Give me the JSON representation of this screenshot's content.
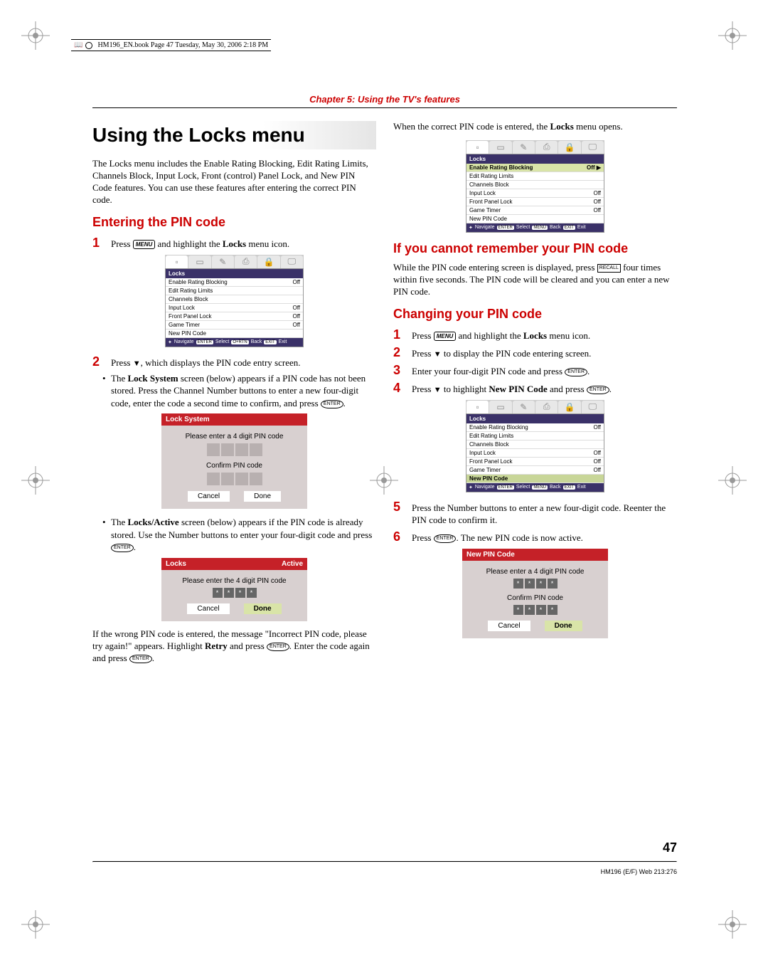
{
  "book_header": "HM196_EN.book  Page 47  Tuesday, May 30, 2006  2:18 PM",
  "chapter": "Chapter 5: Using the TV's features",
  "h1": "Using the Locks menu",
  "intro": "The Locks menu includes the Enable Rating Blocking, Edit Rating Limits, Channels Block, Input Lock, Front (control) Panel Lock, and New PIN Code features. You can use these features after entering the correct PIN code.",
  "sub_enter": "Entering the PIN code",
  "step1_fmt": "Press {MENU} and highlight the {LOCKS} menu icon.",
  "locks_label": "Locks",
  "step2_fmt": "Press {DOWN}, which displays the PIN code entry screen.",
  "bullet1_prefix": "The ",
  "bullet1_strong": "Lock System",
  "bullet1_rest": " screen (below) appears if a PIN code has not been stored. Press the Channel Number buttons to enter a new four-digit code, enter the code a second time to confirm, and press {ENTER}.",
  "dlg1": {
    "title": "Lock System",
    "line1": "Please enter a 4 digit PIN code",
    "line2": "Confirm PIN code",
    "cancel": "Cancel",
    "done": "Done"
  },
  "bullet2_prefix": "The ",
  "bullet2_strong": "Locks/Active",
  "bullet2_rest": " screen (below) appears if the PIN code is already stored. Use the Number buttons to enter your four-digit code and press {ENTER}.",
  "dlg2": {
    "title_l": "Locks",
    "title_r": "Active",
    "line1": "Please enter the 4 digit PIN code",
    "cancel": "Cancel",
    "done": "Done"
  },
  "wrong_pin": "If the wrong PIN code is entered, the message \"Incorrect PIN code, please try again!\" appears. Highlight {RETRY} and press {ENTER}. Enter the code again and press {ENTER}.",
  "retry_label": "Retry",
  "right_top": "When the correct PIN code is entered, the {LOCKS} menu opens.",
  "sub_forgot": "If you cannot remember your PIN code",
  "forgot_text": "While the PIN code entering screen is displayed, press {RECALL} four times within five seconds. The PIN code will be cleared and you can enter a new PIN code.",
  "sub_change": "Changing your PIN code",
  "c1": "Press {MENU} and highlight the {LOCKS} menu icon.",
  "c2": "Press {DOWN} to display the PIN code entering screen.",
  "c3": "Enter your four-digit PIN code and press {ENTER}.",
  "c4": "Press {DOWN} to highlight {NEWPIN} and press {ENTER}.",
  "newpin_label": "New PIN Code",
  "c5": "Press the Number buttons to enter a new four-digit code. Reenter the PIN code to confirm it.",
  "c6": "Press {ENTER}. The new PIN code is now active.",
  "dlg3": {
    "title": "New PIN Code",
    "line1": "Please enter a 4 digit PIN code",
    "line2": "Confirm PIN code",
    "cancel": "Cancel",
    "done": "Done"
  },
  "tv_menu": {
    "title": "Locks",
    "rows": [
      {
        "label": "Enable Rating Blocking",
        "val": "Off",
        "arrow": "▶"
      },
      {
        "label": "Edit Rating Limits",
        "val": ""
      },
      {
        "label": "Channels Block",
        "val": ""
      },
      {
        "label": "Input Lock",
        "val": "Off"
      },
      {
        "label": "Front Panel Lock",
        "val": "Off"
      },
      {
        "label": "Game Timer",
        "val": "Off"
      },
      {
        "label": "New PIN Code",
        "val": ""
      }
    ],
    "foot_nav": "Navigate",
    "foot_sel": "Select",
    "foot_back": "Back",
    "foot_exit": "Exit",
    "foot_enter": "ENTER",
    "foot_menu": "MENU",
    "foot_exitbtn": "EXIT",
    "foot_rtn": "O+RTN"
  },
  "page_num": "47",
  "footer": "HM196 (E/F) Web 213:276"
}
